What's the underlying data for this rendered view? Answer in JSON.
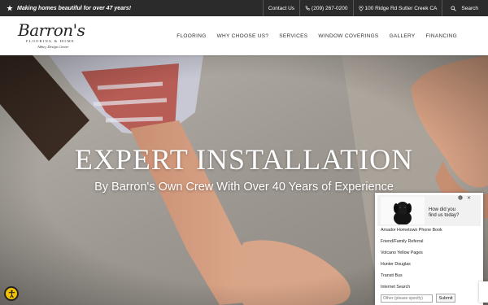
{
  "topbar": {
    "tagline": "Making homes beautiful for over 47 years!",
    "contact": "Contact Us",
    "phone": "(209) 267-0200",
    "address": "100 Ridge Rd Sutter Creek CA",
    "search": "Search"
  },
  "logo": {
    "name": "Barron's",
    "line1": "FLOORING & HOME",
    "line2": "Abbey Design Center"
  },
  "nav": [
    "FLOORING",
    "WHY CHOOSE US?",
    "SERVICES",
    "WINDOW COVERINGS",
    "GALLERY",
    "FINANCING"
  ],
  "hero": {
    "title": "EXPERT INSTALLATION",
    "subtitle": "By Barron's Own Crew With Over 40 Years of Experience"
  },
  "survey": {
    "question_line1": "How did you",
    "question_line2": "find us today?",
    "info": "i",
    "close": "✕",
    "options": [
      "Amador Hometown Phone Book",
      "Friend/Family Referral",
      "Volcano Yellow Pages",
      "Hunter Douglas",
      "Transit Bus",
      "Internet Search"
    ],
    "other_placeholder": "Other (please specify)",
    "submit": "Submit"
  },
  "colors": {
    "topbar_bg": "#2b2b2b",
    "accessibility_yellow": "#f2c200"
  }
}
